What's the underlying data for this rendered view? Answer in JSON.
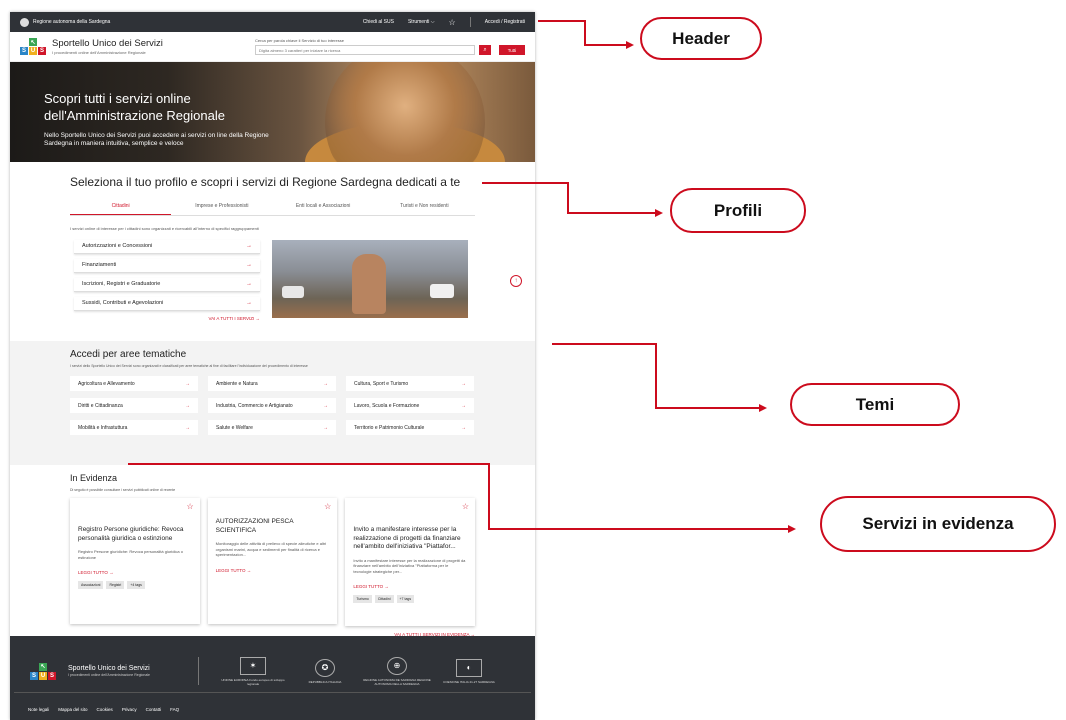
{
  "topbar": {
    "region": "Regione autonoma della Sardegna",
    "chiedi": "Chiedi al SUS",
    "strumenti": "Strumenti ⌵",
    "star": "☆",
    "accedi": "Accedi / Registrati"
  },
  "brand": {
    "logo": [
      "S",
      "U",
      "S"
    ],
    "title": "Sportello Unico dei Servizi",
    "subtitle": "I procedimenti online dell'Amministrazione Regionale"
  },
  "search": {
    "label": "Cerca per parola chiave il Servizio di tuo interesse",
    "placeholder": "Digita almeno 3 caratteri per iniziare la ricerca",
    "search_icon": "⌕",
    "all_button": "Tutti"
  },
  "hero": {
    "title_l1": "Scopri tutti i servizi online",
    "title_l2": "dell'Amministrazione Regionale",
    "text": "Nello Sportello Unico dei Servizi puoi accedere ai servizi on line della Regione Sardegna in maniera intuitiva, semplice e veloce"
  },
  "profili": {
    "title": "Seleziona il tuo profilo e scopri i servizi di Regione Sardegna dedicati a te",
    "tabs": [
      "Cittadini",
      "Imprese e Professionisti",
      "Enti locali e Associazioni",
      "Turisti e Non residenti"
    ],
    "desc": "I servizi online di interesse per i cittadini sono organizzati e ricercabili all'interno di specifici raggruppamenti",
    "items": [
      "Autorizzazioni e Concessioni",
      "Finanziamenti",
      "Iscrizioni, Registri e Graduatorie",
      "Sussidi, Contributi e Agevolazioni"
    ],
    "arrow": "→",
    "vai": "VAI A TUTTI I SERVIZI →",
    "up": "↑"
  },
  "temi": {
    "title": "Accedi per aree tematiche",
    "desc": "I servizi dello Sportello Unico dei Servizi sono organizzati e classificati per aree tematiche al fine di facilitare l'individuazione del procedimento di interesse",
    "items": [
      "Agricoltura e Allevamento",
      "Ambiente e Natura",
      "Cultura, Sport e Turismo",
      "Diritti e Cittadinanza",
      "Industria, Commercio e Artigianato",
      "Lavoro, Scuola e Formazione",
      "Mobilità e Infrastuttura",
      "Salute e Welfare",
      "Territorio e Patrimonio Culturale"
    ]
  },
  "evidenza": {
    "title": "In Evidenza",
    "desc": "Di seguito è possibile consultare i servizi pubblicati online di recente",
    "cards": [
      {
        "title": "Registro Persone giuridiche: Revoca personalità giuridica o estinzione",
        "body": "Registro Persone giuridiche: Revoca personalità giuridica o estinzione",
        "more": "LEGGI TUTTO →",
        "tags": [
          "Associazioni",
          "Registri",
          "+4 tags"
        ]
      },
      {
        "title": "AUTORIZZAZIONI PESCA SCIENTIFICA",
        "body": "Monitoraggio delle attività di prelievo di specie alieutiche e altri organismi marini, acqua e sedimenti per finalità di ricerca e sperimentazion...",
        "more": "LEGGI TUTTO →",
        "tags": []
      },
      {
        "title": "Invito a manifestare interesse per la realizzazione di progetti da finanziare nell'ambito dell'iniziativa \"Piattafor...",
        "body": "Invito a manifestare interesse per la realizzazione di progetti da finanziare nell'ambito dell'iniziativa \"Piattaforma per le tecnologie strategiche per...",
        "more": "LEGGI TUTTO →",
        "tags": [
          "Turismo",
          "Cittadini",
          "+7 tags"
        ]
      }
    ],
    "star": "☆",
    "vai": "VAI A TUTTI I SERVIZI IN EVIDENZA →"
  },
  "footer": {
    "title": "Sportello Unico dei Servizi",
    "subtitle": "I procedimenti online dell'Amministrazione Regionale",
    "partners": [
      {
        "icon": "✶",
        "text": "UNIONE EUROPEA Fondo europeo di sviluppo regionale"
      },
      {
        "icon": "✪",
        "text": "REPUBBLICA ITALIANA"
      },
      {
        "icon": "⊕",
        "text": "REGIONE AUTONOMA DE SARDIGNA REGIONE AUTONOMA DELLA SARDEGNA"
      },
      {
        "icon": "◐",
        "text": "COESIONE ITALIA 21-27 SARDEGNA"
      }
    ],
    "links": [
      "Note legali",
      "Mappa del sito",
      "Cookies",
      "Privacy",
      "Contatti",
      "FAQ"
    ]
  },
  "annotations": [
    "Header",
    "Profili",
    "Temi",
    "Servizi in evidenza"
  ],
  "colors": {
    "accent": "#d0162a",
    "annotation": "#cc0b1d",
    "dark": "#2f3237"
  }
}
